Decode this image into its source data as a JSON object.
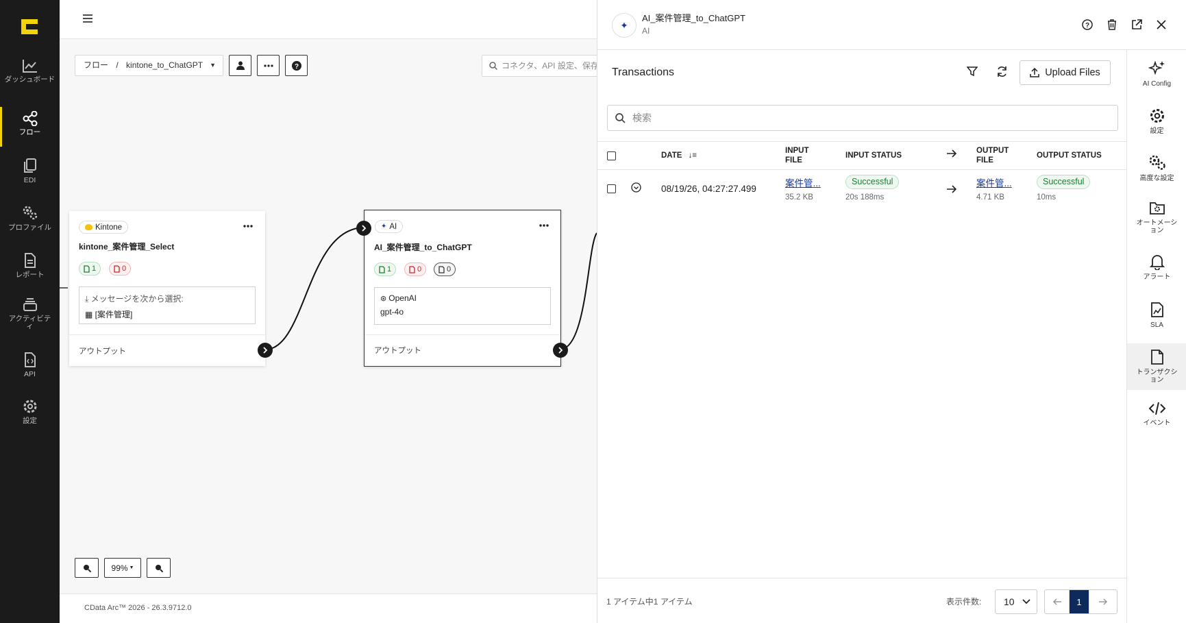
{
  "sidebar": {
    "logo": "C",
    "items": [
      {
        "label": "ダッシュボード",
        "icon": "chart-line-icon"
      },
      {
        "label": "フロー",
        "icon": "share-nodes-icon",
        "active": true
      },
      {
        "label": "EDI",
        "icon": "documents-icon"
      },
      {
        "label": "プロファイル",
        "icon": "gears-icon"
      },
      {
        "label": "レポート",
        "icon": "report-icon"
      },
      {
        "label": "アクティビティ",
        "icon": "layers-icon"
      },
      {
        "label": "API",
        "icon": "api-file-icon"
      },
      {
        "label": "設定",
        "icon": "gear-icon"
      }
    ]
  },
  "toolbar": {
    "breadcrumb_root": "フロー",
    "breadcrumb_sep": "/",
    "breadcrumb_current": "kintone_to_ChatGPT",
    "search_placeholder": "コネクタ、API 設定、保存"
  },
  "nodes": {
    "kintone": {
      "type_label": "Kintone",
      "name": "kintone_案件管理_Select",
      "green_count": "1",
      "red_count": "0",
      "detail_line1": "メッセージを次から選択:",
      "detail_line2": "[案件管理]",
      "output_label": "アウトプット"
    },
    "ai": {
      "type_label": "AI",
      "name": "AI_案件管理_to_ChatGPT",
      "green_count": "1",
      "red_count": "0",
      "gray_count": "0",
      "detail_line1": "OpenAI",
      "detail_line2": "gpt-4o",
      "output_label": "アウトプット"
    }
  },
  "zoom": {
    "level": "99%"
  },
  "footer": {
    "version": "CData Arc™ 2026 - 26.3.9712.0"
  },
  "panel": {
    "title": "AI_案件管理_to_ChatGPT",
    "subtitle": "AI",
    "section_title": "Transactions",
    "upload_label": "Upload Files",
    "search_placeholder": "検索",
    "columns": {
      "date": "DATE",
      "input_file": "INPUT FILE",
      "input_status": "INPUT STATUS",
      "output_file": "OUTPUT FILE",
      "output_status": "OUTPUT STATUS"
    },
    "rows": [
      {
        "date": "08/19/26, 04:27:27.499",
        "input_file": "案件管...",
        "input_size": "35.2 KB",
        "input_status": "Successful",
        "input_time": "20s 188ms",
        "output_file": "案件管...",
        "output_size": "4.71 KB",
        "output_status": "Successful",
        "output_time": "10ms"
      }
    ],
    "footer": {
      "summary": "1 アイテム中1 アイテム",
      "page_size_label": "表示件数:",
      "page_size": "10",
      "current_page": "1"
    }
  },
  "right_nav": [
    {
      "label": "AI Config",
      "icon": "sparkles-icon"
    },
    {
      "label": "設定",
      "icon": "gear-icon"
    },
    {
      "label": "高度な設定",
      "icon": "gears-icon"
    },
    {
      "label": "オートメーション",
      "icon": "folder-gear-icon"
    },
    {
      "label": "アラート",
      "icon": "bell-icon"
    },
    {
      "label": "SLA",
      "icon": "sla-file-icon"
    },
    {
      "label": "トランザクション",
      "icon": "file-icon",
      "active": true
    },
    {
      "label": "イベント",
      "icon": "code-icon"
    }
  ],
  "colors": {
    "sidebar_bg": "#1b1b1b",
    "accent": "#f1d30a",
    "success": "#1e7b34",
    "link": "#1a3b9c"
  }
}
